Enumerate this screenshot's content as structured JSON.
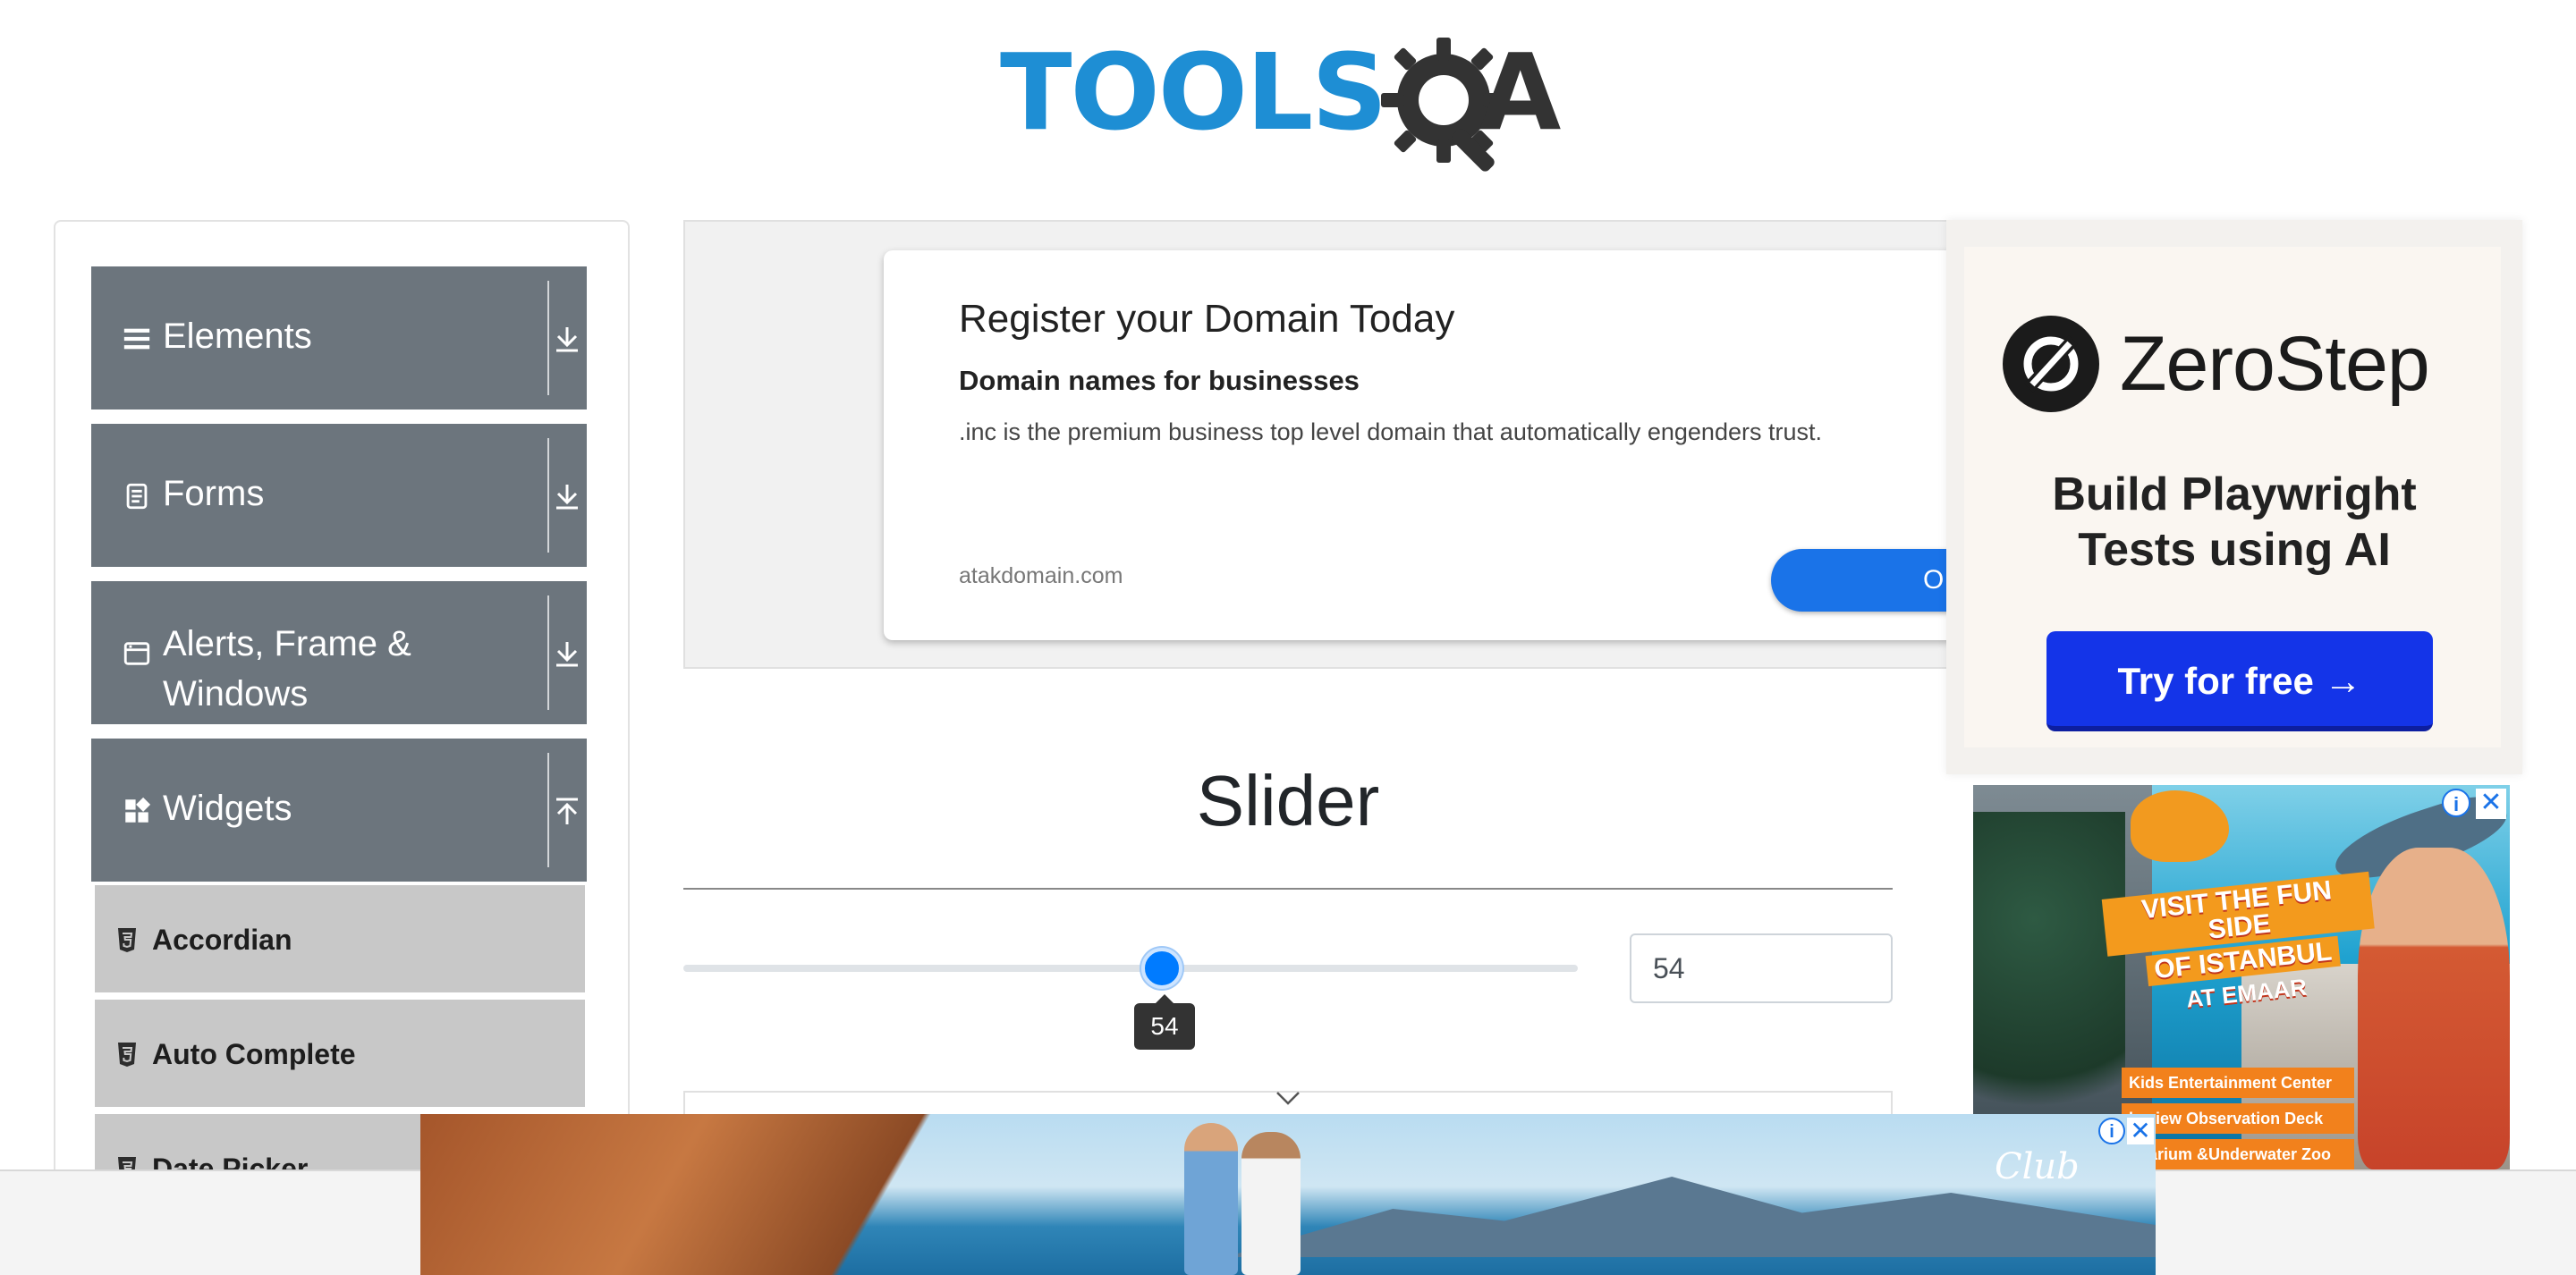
{
  "header": {
    "logo_text": "TOOLS",
    "logo_suffix": "A"
  },
  "sidebar": {
    "groups": [
      {
        "label": "Elements",
        "icon": "hamburger-icon",
        "arrow": "download-arrow-icon"
      },
      {
        "label": "Forms",
        "icon": "document-icon",
        "arrow": "download-arrow-icon"
      },
      {
        "label": "Alerts, Frame &",
        "label_line2": "Windows",
        "icon": "window-icon",
        "arrow": "download-arrow-icon"
      },
      {
        "label": "Widgets",
        "icon": "widgets-grid-icon",
        "arrow": "upload-arrow-icon"
      }
    ],
    "submenu": [
      {
        "label": "Accordian",
        "icon": "html5-icon"
      },
      {
        "label": "Auto Complete",
        "icon": "html5-icon"
      },
      {
        "label": "Date Picker",
        "icon": "html5-icon"
      }
    ]
  },
  "ad_main": {
    "title": "Register your Domain Today",
    "subtitle": "Domain names for businesses",
    "body": ".inc is the premium business top level domain that automatically engenders trust.",
    "url": "atakdomain.com",
    "cta": "O"
  },
  "slider": {
    "title": "Slider",
    "value": 54,
    "min": 0,
    "max": 100,
    "tooltip": "54",
    "input_value": "54"
  },
  "ad_zerostep": {
    "brand": "ZeroStep",
    "headline_line1": "Build Playwright",
    "headline_line2": "Tests using AI",
    "cta": "Try for free →"
  },
  "ad_emaar": {
    "headline_l1": "VISIT THE FUN SIDE",
    "headline_l2": "OF ISTANBUL",
    "headline_l3": "AT EMAAR",
    "items": [
      "Kids Entertainment Center",
      "kyview Observation Deck",
      "quarium &Underwater Zoo"
    ],
    "info": "i",
    "close": "✕"
  },
  "ad_bottom": {
    "brand": "Club",
    "info": "i",
    "close": "✕"
  },
  "colors": {
    "accent": "#007bff",
    "sidebar_group": "#6c757d",
    "sidebar_item": "#c8c8c8",
    "logo_blue": "#1e8ed4",
    "zerostep_cta": "#1434e8"
  }
}
